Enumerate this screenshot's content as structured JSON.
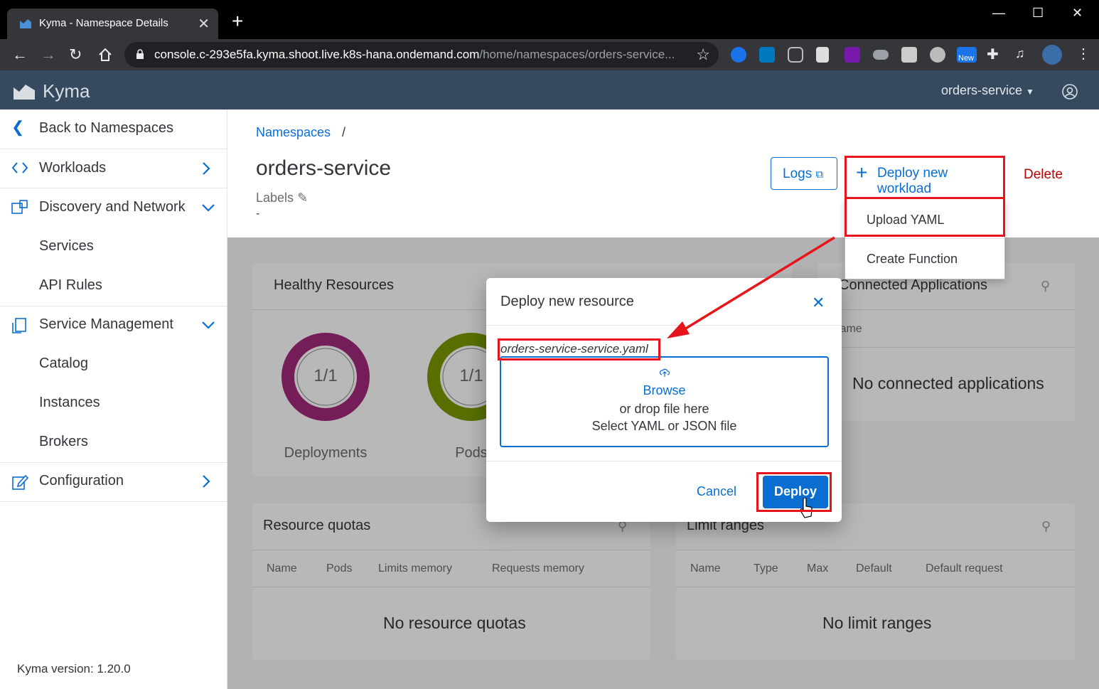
{
  "browser": {
    "tab_title": "Kyma - Namespace Details",
    "url_host": "console.c-293e5fa.kyma.shoot.live.k8s-hana.ondemand.com",
    "url_path": "/home/namespaces/orders-service...",
    "new_badge": "New"
  },
  "app": {
    "logo_text": "Kyma",
    "namespace_selector": "orders-service",
    "accent": "#0a6ed1"
  },
  "sidebar": {
    "back": "Back to Namespaces",
    "workloads": "Workloads",
    "discovery": "Discovery and Network",
    "services": "Services",
    "api_rules": "API Rules",
    "service_management": "Service Management",
    "catalog": "Catalog",
    "instances": "Instances",
    "brokers": "Brokers",
    "configuration": "Configuration",
    "version": "Kyma version: 1.20.0"
  },
  "page": {
    "breadcrumb_link": "Namespaces",
    "breadcrumb_sep": "/",
    "title": "orders-service",
    "labels_label": "Labels",
    "labels_value": "-",
    "logs_btn": "Logs",
    "deploy_workload_btn": "Deploy new workload",
    "delete_btn": "Delete"
  },
  "dropdown": {
    "upload_yaml": "Upload YAML",
    "create_function": "Create Function"
  },
  "healthy": {
    "title": "Healthy Resources",
    "deployments_value": "1/1",
    "deployments_label": "Deployments",
    "pods_value": "1/1",
    "pods_label": "Pods"
  },
  "connected": {
    "title": "Connected Applications",
    "col_name": "Name",
    "empty": "No connected applications"
  },
  "quotas": {
    "title": "Resource quotas",
    "cols": [
      "Name",
      "Pods",
      "Limits memory",
      "Requests memory"
    ],
    "empty": "No resource quotas"
  },
  "limits": {
    "title": "Limit ranges",
    "cols": [
      "Name",
      "Type",
      "Max",
      "Default",
      "Default request"
    ],
    "empty": "No limit ranges"
  },
  "modal": {
    "title": "Deploy new resource",
    "filename": "orders-service-service.yaml",
    "browse": "Browse",
    "or_drop": "or drop file here",
    "hint": "Select YAML or JSON file",
    "cancel": "Cancel",
    "deploy": "Deploy"
  }
}
